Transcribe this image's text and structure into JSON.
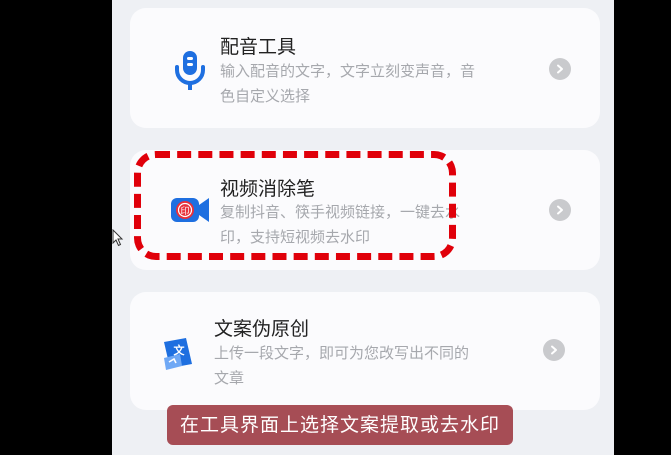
{
  "tools": [
    {
      "title": "配音工具",
      "desc": "输入配音的文字，文字立刻变声音，音色自定义选择",
      "icon": "microphone-icon"
    },
    {
      "title": "视频消除笔",
      "desc": "复制抖音、筷手视频链接，一键去水印，支持短视频去水印",
      "icon": "video-stamp-icon"
    },
    {
      "title": "文案伪原创",
      "desc": "上传一段文字，即可为您改写出不同的文章",
      "icon": "rewrite-text-icon"
    }
  ],
  "caption": "在工具界面上选择文案提取或去水印",
  "colors": {
    "accent": "#1e6fe0",
    "highlight": "#e0000a",
    "caption_bg": "#962832"
  }
}
